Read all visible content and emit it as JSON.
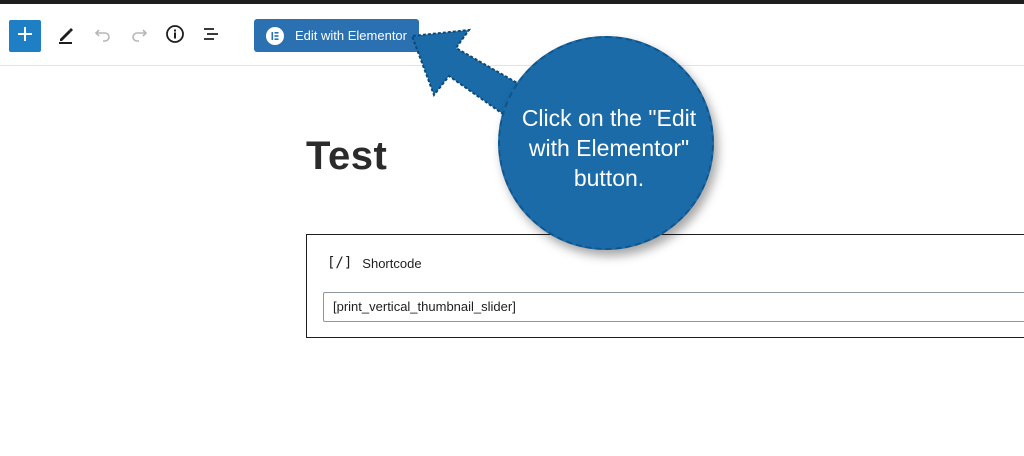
{
  "toolbar": {
    "add_label": "+",
    "elementor_button_label": "Edit with Elementor",
    "icons": [
      "plus-icon",
      "pencil-icon",
      "undo-icon",
      "redo-icon",
      "info-icon",
      "list-view-icon",
      "elementor-logo-icon"
    ]
  },
  "post": {
    "title": "Test"
  },
  "shortcode_block": {
    "icon_text": "[/]",
    "label": "Shortcode",
    "value": "[print_vertical_thumbnail_slider]"
  },
  "callout": {
    "text": "Click on the \"Edit with Elementor\" button."
  },
  "colors": {
    "accent": "#1f7fc4",
    "elementor_button": "#2b70b0",
    "callout": "#1a6ba8"
  }
}
